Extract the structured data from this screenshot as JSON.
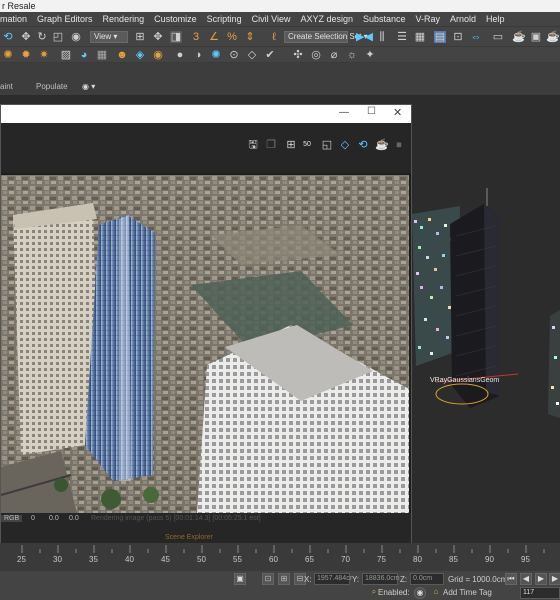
{
  "window": {
    "title": "r Resale"
  },
  "menu": [
    "mation",
    "Graph Editors",
    "Rendering",
    "Customize",
    "Scripting",
    "Civil View",
    "AXYZ design",
    "Substance",
    "V-Ray",
    "Arnold",
    "Help"
  ],
  "toolbar": {
    "view_select": "View",
    "selection_set": "Create Selection Set"
  },
  "tabs": {
    "left": "aint",
    "populate": "Populate"
  },
  "render_window": {
    "status_channel": "RGB",
    "values": [
      "0",
      "0.0",
      "0.0"
    ],
    "progress_text": "Rendering image (pass 5) [00:01:14.3] [00:05:25.1 est]",
    "explorer_text": "Scene Explorer"
  },
  "viewport": {
    "object_label": "VRayGaussiansGeom"
  },
  "timeline": {
    "ticks": [
      "25",
      "30",
      "35",
      "40",
      "45",
      "50",
      "55",
      "60",
      "65",
      "70",
      "75",
      "80",
      "85",
      "90",
      "95"
    ]
  },
  "status": {
    "x_label": "X:",
    "x_value": "1957.484cr",
    "y_label": "Y:",
    "y_value": "18836.0cm",
    "z_label": "Z:",
    "z_value": "0.0cm",
    "grid": "Grid = 1000.0cm",
    "enabled": "Enabled:",
    "add_time_tag": "Add Time Tag",
    "frame": "117"
  }
}
